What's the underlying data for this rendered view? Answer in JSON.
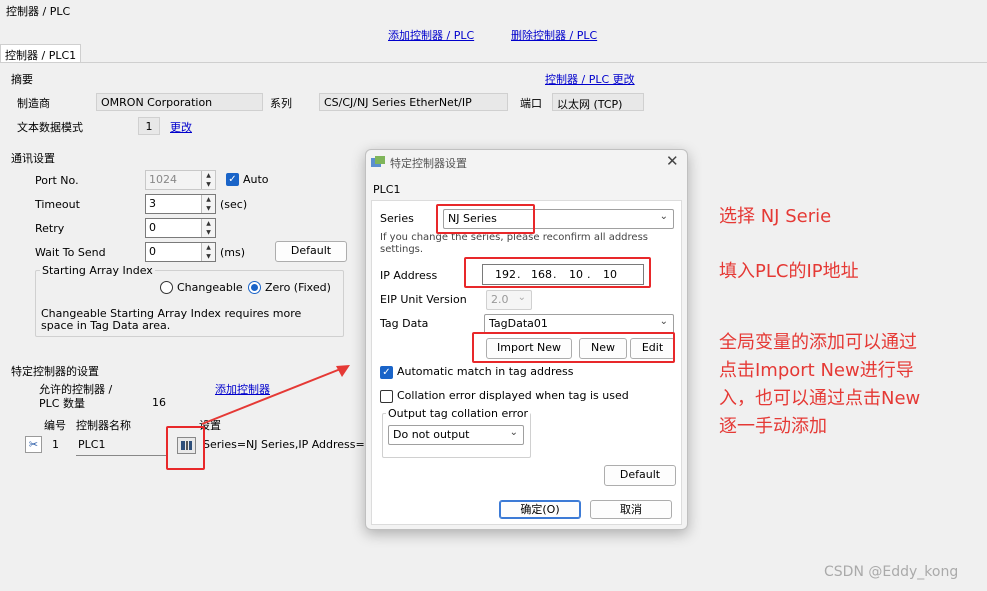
{
  "window": {
    "title": "控制器 / PLC"
  },
  "top_links": {
    "add": "添加控制器 / PLC",
    "delete": "删除控制器 / PLC"
  },
  "tab": {
    "label": "控制器 / PLC1"
  },
  "summary": {
    "heading": "摘要",
    "change_link": "控制器 / PLC 更改",
    "maker_label": "制造商",
    "maker_value": "OMRON Corporation",
    "series_label": "系列",
    "series_value": "CS/CJ/NJ Series EtherNet/IP",
    "port_label": "端口",
    "port_value": "以太网 (TCP)",
    "text_mode_label": "文本数据模式",
    "text_mode_value": "1",
    "text_mode_change": "更改"
  },
  "comm": {
    "heading": "通讯设置",
    "port_no_label": "Port No.",
    "port_no_value": "1024",
    "auto_label": "Auto",
    "timeout_label": "Timeout",
    "timeout_value": "3",
    "timeout_unit": "(sec)",
    "retry_label": "Retry",
    "retry_value": "0",
    "wait_label": "Wait To Send",
    "wait_value": "0",
    "wait_unit": "(ms)",
    "default_button": "Default",
    "array_group_title": "Starting Array Index",
    "changeable_label": "Changeable",
    "zero_label": "Zero (Fixed)",
    "array_note": "Changeable Starting Array Index requires more space in Tag Data area."
  },
  "specific": {
    "heading": "特定控制器的设置",
    "allowed_label_1": "允许的控制器 /",
    "allowed_label_2": "PLC 数量",
    "allowed_value": "16",
    "add_link": "添加控制器",
    "col_no": "编号",
    "col_name": "控制器名称",
    "col_settings": "设置",
    "row_no": "1",
    "row_name": "PLC1",
    "row_settings": "Series=NJ Series,IP Address=192."
  },
  "dialog": {
    "title": "特定控制器设置",
    "subtitle": "PLC1",
    "series_label": "Series",
    "series_value": "NJ Series",
    "series_note": "If you change the series, please reconfirm all address settings.",
    "ip_label": "IP Address",
    "ip_octets": [
      "192",
      "168",
      "10",
      "10"
    ],
    "eip_label": "EIP Unit Version",
    "eip_value": "2.0",
    "tag_label": "Tag Data",
    "tag_value": "TagData01",
    "import_button": "Import New",
    "new_button": "New",
    "edit_button": "Edit",
    "auto_match_label": "Automatic match in tag address",
    "collation_label": "Collation error displayed when tag is used",
    "output_group_title": "Output tag collation error",
    "output_value": "Do not output",
    "default_button": "Default",
    "ok_button": "确定(O)",
    "cancel_button": "取消"
  },
  "annotations": {
    "a1": "选择 NJ Serie",
    "a2": "填入PLC的IP地址",
    "a3_lines": [
      "全局变量的添加可以通过",
      "点击Import New进行导",
      "入，也可以通过点击New",
      "逐一手动添加"
    ]
  },
  "watermark": "CSDN @Eddy_kong",
  "colors": {
    "annotation_red": "#e53935",
    "link_blue": "#0000cc",
    "checkbox_blue": "#1a64c8"
  }
}
